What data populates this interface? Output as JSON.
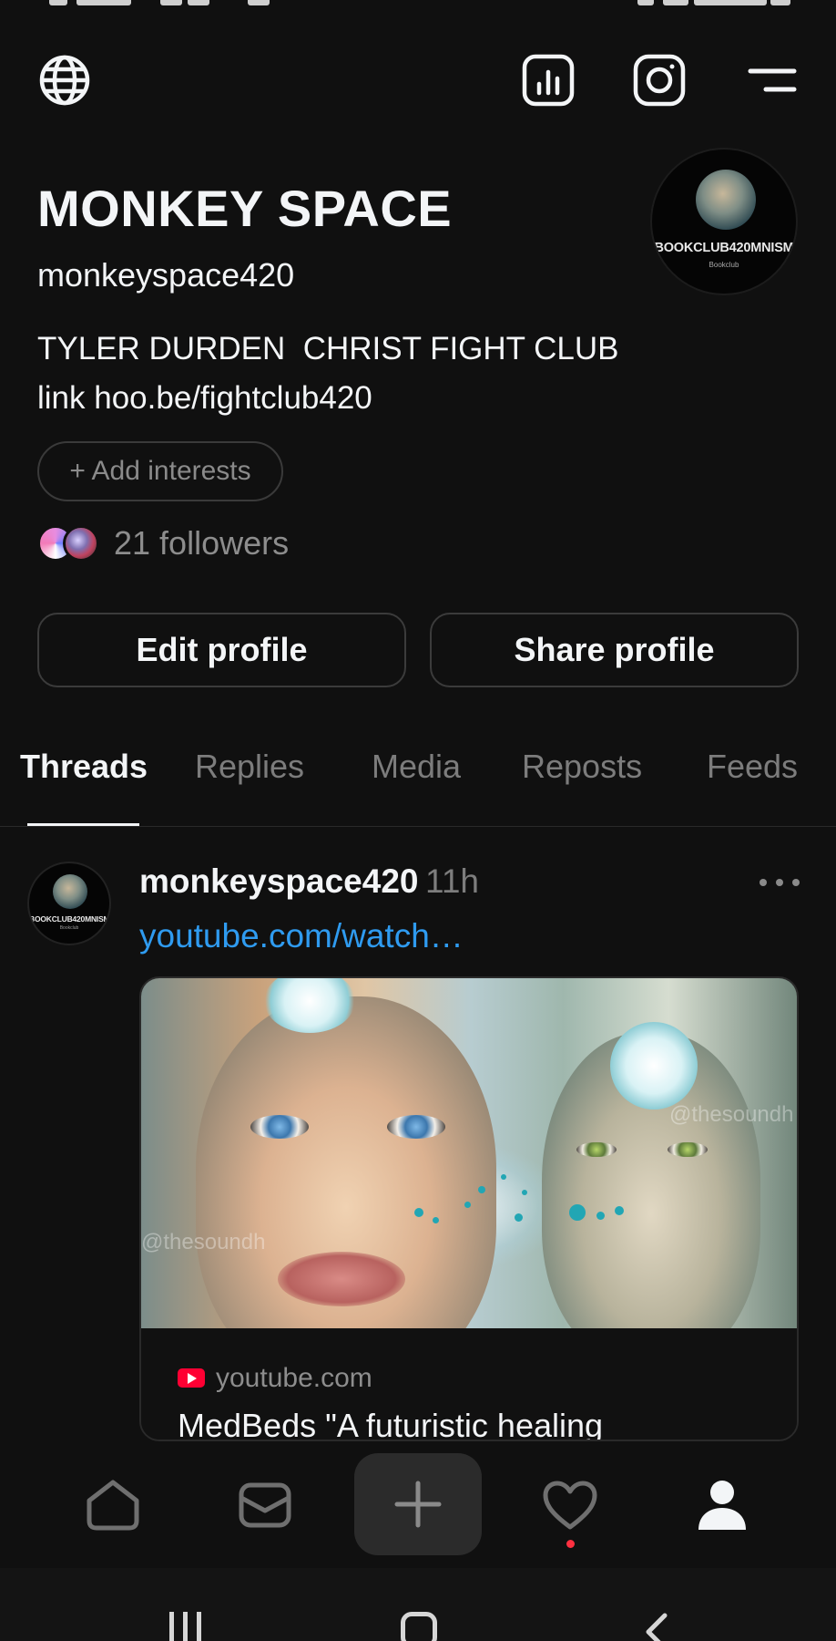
{
  "profile": {
    "display_name": "MONKEY SPACE",
    "username": "monkeyspace420",
    "bio": "TYLER DURDEN  CHRIST FIGHT CLUB\nlink hoo.be/fightclub420",
    "avatar_label": "BOOKCLUB420MNISM",
    "avatar_sublabel": "Bookclub",
    "add_interests_label": "+ Add interests",
    "followers_text": "21 followers",
    "edit_profile_label": "Edit profile",
    "share_profile_label": "Share profile"
  },
  "topbar": {
    "left_icon": "globe-icon",
    "right_icons": [
      "insights-icon",
      "instagram-icon",
      "menu-icon"
    ]
  },
  "tabs": [
    {
      "label": "Threads",
      "active": true
    },
    {
      "label": "Replies",
      "active": false
    },
    {
      "label": "Media",
      "active": false
    },
    {
      "label": "Reposts",
      "active": false
    },
    {
      "label": "Feeds",
      "active": false
    }
  ],
  "post": {
    "username": "monkeyspace420",
    "time": "11h",
    "link_text": "youtube.com/watch…",
    "avatar_label": "BOOKCLUB420MNISM",
    "avatar_sublabel": "Bookclub",
    "card": {
      "watermark": "@thesoundh",
      "domain": "youtube.com",
      "title": "MedBeds \"A futuristic healing"
    }
  },
  "bottom_nav": [
    "home-icon",
    "inbox-icon",
    "compose-icon",
    "activity-icon",
    "profile-icon"
  ],
  "colors": {
    "background": "#101010",
    "text": "#f3f5f7",
    "muted": "#7c7c7c",
    "link": "#2f9bf0",
    "notification": "#ff3040",
    "youtube": "#ff0033"
  }
}
